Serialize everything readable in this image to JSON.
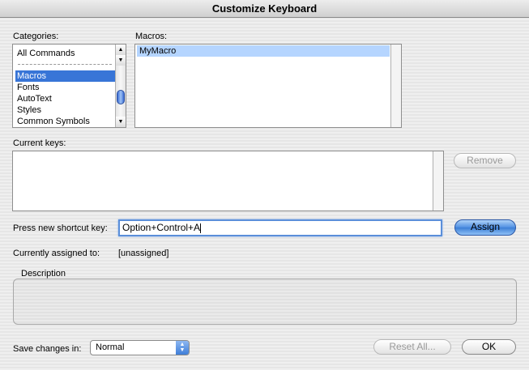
{
  "window": {
    "title": "Customize Keyboard"
  },
  "categories": {
    "label": "Categories:",
    "items": [
      "All Commands",
      "Macros",
      "Fonts",
      "AutoText",
      "Styles",
      "Common Symbols"
    ],
    "selected": "Macros"
  },
  "macros": {
    "label": "Macros:",
    "items": [
      "MyMacro"
    ]
  },
  "current_keys": {
    "label": "Current keys:"
  },
  "buttons": {
    "remove": "Remove",
    "assign": "Assign",
    "reset_all": "Reset All...",
    "ok": "OK"
  },
  "shortcut": {
    "label": "Press new shortcut key:",
    "value": "Option+Control+A"
  },
  "assigned": {
    "label": "Currently assigned to:",
    "value": "[unassigned]"
  },
  "description": {
    "label": "Description"
  },
  "save_in": {
    "label": "Save changes in:",
    "value": "Normal"
  },
  "icons": {
    "scroll_up": "triangle-up-icon",
    "scroll_down": "triangle-down-icon",
    "popup": "up-down-arrows-icon"
  }
}
